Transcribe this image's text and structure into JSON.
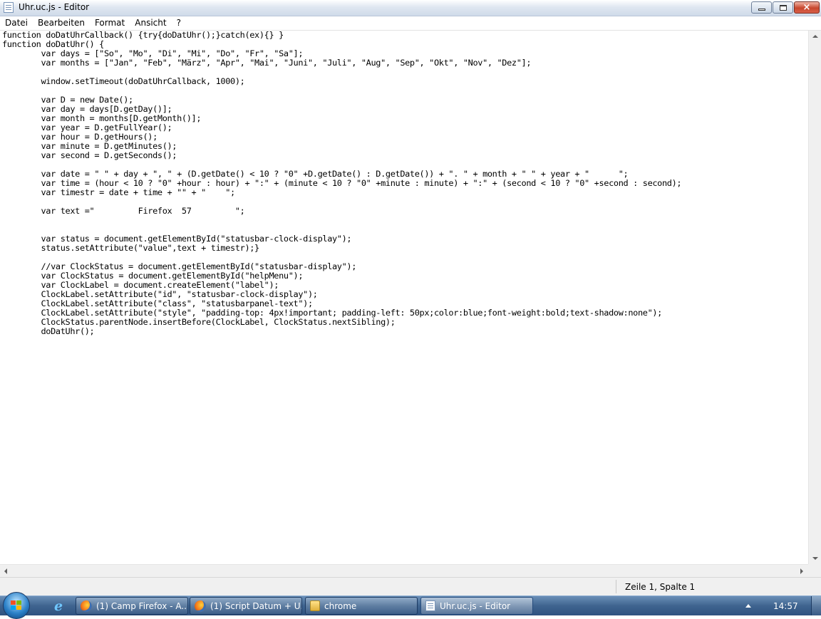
{
  "window": {
    "title": "Uhr.uc.js - Editor",
    "close_glyph": "×"
  },
  "menu": {
    "items": [
      "Datei",
      "Bearbeiten",
      "Format",
      "Ansicht",
      "?"
    ]
  },
  "editor": {
    "lines": [
      "function doDatUhrCallback() {try{doDatUhr();}catch(ex){} }",
      "function doDatUhr() {",
      "        var days = [\"So\", \"Mo\", \"Di\", \"Mi\", \"Do\", \"Fr\", \"Sa\"];",
      "        var months = [\"Jan\", \"Feb\", \"März\", \"Apr\", \"Mai\", \"Juni\", \"Juli\", \"Aug\", \"Sep\", \"Okt\", \"Nov\", \"Dez\"];",
      "",
      "        window.setTimeout(doDatUhrCallback, 1000);",
      "",
      "        var D = new Date();",
      "        var day = days[D.getDay()];",
      "        var month = months[D.getMonth()];",
      "        var year = D.getFullYear();",
      "        var hour = D.getHours();",
      "        var minute = D.getMinutes();",
      "        var second = D.getSeconds();",
      "",
      "        var date = \" \" + day + \", \" + (D.getDate() < 10 ? \"0\" +D.getDate() : D.getDate()) + \". \" + month + \" \" + year + \"      \";",
      "        var time = (hour < 10 ? \"0\" +hour : hour) + \":\" + (minute < 10 ? \"0\" +minute : minute) + \":\" + (second < 10 ? \"0\" +second : second);",
      "        var timestr = date + time + \"\" + \"    \";",
      "",
      "        var text =\"         Firefox  57         \";",
      "",
      "",
      "        var status = document.getElementById(\"statusbar-clock-display\");",
      "        status.setAttribute(\"value\",text + timestr);}",
      "",
      "        //var ClockStatus = document.getElementById(\"statusbar-display\");",
      "        var ClockStatus = document.getElementById(\"helpMenu\");",
      "        var ClockLabel = document.createElement(\"label\");",
      "        ClockLabel.setAttribute(\"id\", \"statusbar-clock-display\");",
      "        ClockLabel.setAttribute(\"class\", \"statusbarpanel-text\");",
      "        ClockLabel.setAttribute(\"style\", \"padding-top: 4px!important; padding-left: 50px;color:blue;font-weight:bold;text-shadow:none\");",
      "        ClockStatus.parentNode.insertBefore(ClockLabel, ClockStatus.nextSibling);",
      "        doDatUhr();"
    ]
  },
  "statusbar": {
    "position": "Zeile 1, Spalte 1"
  },
  "taskbar": {
    "buttons": [
      {
        "label": "(1) Camp Firefox - A...",
        "icon": "firefox-icon"
      },
      {
        "label": "(1) Script Datum + U...",
        "icon": "firefox-icon"
      },
      {
        "label": "chrome",
        "icon": "folder-icon"
      },
      {
        "label": "Uhr.uc.js - Editor",
        "icon": "notepad-icon"
      }
    ],
    "clock": "14:57"
  }
}
